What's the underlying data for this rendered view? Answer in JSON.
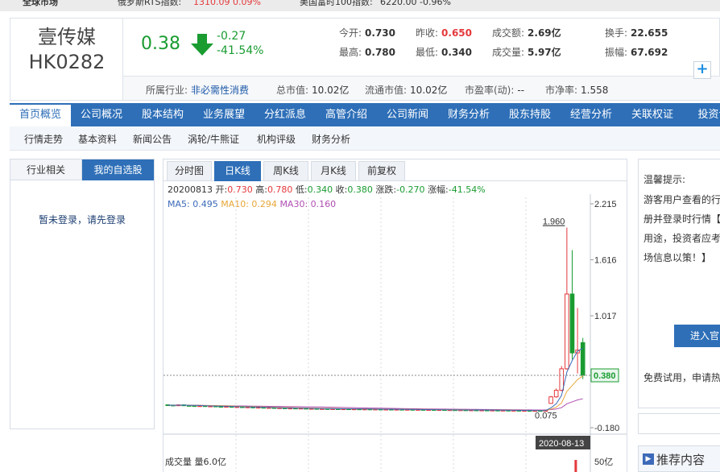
{
  "ticker": {
    "item1_label": "俄罗斯RTS指数:",
    "item1_value": "1310.09 0.09%",
    "item2_label": "美国富时100指数:",
    "item2_value": "6220.00 -0.96%",
    "first_label": "全球市场"
  },
  "stock": {
    "name": "壹传媒",
    "code": "HK0282",
    "price": "0.38",
    "change": "-0.27",
    "change_pct": "-41.54%",
    "open_label": "今开:",
    "open": "0.730",
    "prev_close_label": "昨收:",
    "prev_close": "0.650",
    "turnover_label": "成交额:",
    "turnover": "2.69亿",
    "turnover_rate_label": "换手:",
    "turnover_rate": "22.655",
    "high_label": "最高:",
    "high": "0.780",
    "low_label": "最低:",
    "low": "0.340",
    "volume_label": "成交量:",
    "volume": "5.97亿",
    "amplitude_label": "振幅:",
    "amplitude": "67.692"
  },
  "info": {
    "industry_label": "所属行业:",
    "industry": "非必需性消费",
    "mcap_label": "总市值:",
    "mcap": "10.02亿",
    "float_mcap_label": "流通市值:",
    "float_mcap": "10.02亿",
    "pe_label": "市盈率(动):",
    "pe": "--",
    "pb_label": "市净率:",
    "pb": "1.558",
    "plus_label": "+"
  },
  "main_nav": [
    "首页概览",
    "公司概况",
    "股本结构",
    "业务展望",
    "分红派息",
    "高管介绍",
    "公司新闻",
    "财务分析",
    "股东持股",
    "经营分析",
    "关联权证",
    "投资评"
  ],
  "sub_nav": [
    "行情走势",
    "基本资料",
    "新闻公告",
    "涡轮/牛熊证",
    "机构评级",
    "财务分析"
  ],
  "left_panel": {
    "tab1": "行业相关",
    "tab2": "我的自选股",
    "login_msg": "暂未登录，请先登录"
  },
  "chart_tabs": [
    "分时图",
    "日K线",
    "周K线",
    "月K线",
    "前复权"
  ],
  "ohlc": {
    "date": "20200813",
    "open_label": "开:",
    "open": "0.730",
    "high_label": "高:",
    "high": "0.780",
    "low_label": "低:",
    "low": "0.340",
    "close_label": "收:",
    "close": "0.380",
    "change_label": "涨跌:",
    "change": "-0.270",
    "pct_label": "涨幅:",
    "pct": "-41.54%"
  },
  "ma": {
    "ma5": "MA5: 0.495",
    "ma10": "MA10: 0.294",
    "ma30": "MA30: 0.160"
  },
  "chart_data": {
    "type": "candlestick",
    "y_ticks": [
      "2.215",
      "1.616",
      "1.017",
      "0.380",
      "-0.180"
    ],
    "ylim": [
      -0.18,
      2.215
    ],
    "max_label": "1.960",
    "min_label": "0.075",
    "current_price_label": "0.380",
    "date_label": "2020-08-13",
    "colors": {
      "up": "#e4393c",
      "down": "#1a9c31",
      "ma5": "#3d6ab8",
      "ma10": "#e7a73a",
      "ma30": "#b04fb3"
    },
    "candles": [
      {
        "o": 0.065,
        "h": 0.07,
        "l": 0.058,
        "c": 0.062
      },
      {
        "o": 0.062,
        "h": 0.066,
        "l": 0.056,
        "c": 0.059
      },
      {
        "o": 0.06,
        "h": 0.068,
        "l": 0.055,
        "c": 0.064
      },
      {
        "o": 0.064,
        "h": 0.068,
        "l": 0.058,
        "c": 0.06
      },
      {
        "o": 0.058,
        "h": 0.062,
        "l": 0.052,
        "c": 0.056
      },
      {
        "o": 0.056,
        "h": 0.06,
        "l": 0.05,
        "c": 0.054
      },
      {
        "o": 0.053,
        "h": 0.058,
        "l": 0.048,
        "c": 0.055
      },
      {
        "o": 0.055,
        "h": 0.058,
        "l": 0.049,
        "c": 0.05
      },
      {
        "o": 0.05,
        "h": 0.054,
        "l": 0.046,
        "c": 0.052
      },
      {
        "o": 0.052,
        "h": 0.056,
        "l": 0.047,
        "c": 0.049
      },
      {
        "o": 0.048,
        "h": 0.052,
        "l": 0.044,
        "c": 0.046
      },
      {
        "o": 0.046,
        "h": 0.05,
        "l": 0.042,
        "c": 0.048
      },
      {
        "o": 0.047,
        "h": 0.05,
        "l": 0.041,
        "c": 0.043
      },
      {
        "o": 0.043,
        "h": 0.047,
        "l": 0.039,
        "c": 0.045
      },
      {
        "o": 0.044,
        "h": 0.047,
        "l": 0.038,
        "c": 0.04
      },
      {
        "o": 0.04,
        "h": 0.044,
        "l": 0.036,
        "c": 0.042
      },
      {
        "o": 0.041,
        "h": 0.044,
        "l": 0.035,
        "c": 0.037
      },
      {
        "o": 0.037,
        "h": 0.041,
        "l": 0.033,
        "c": 0.039
      },
      {
        "o": 0.038,
        "h": 0.041,
        "l": 0.032,
        "c": 0.034
      },
      {
        "o": 0.034,
        "h": 0.038,
        "l": 0.03,
        "c": 0.036
      },
      {
        "o": 0.035,
        "h": 0.038,
        "l": 0.029,
        "c": 0.031
      },
      {
        "o": 0.031,
        "h": 0.035,
        "l": 0.027,
        "c": 0.033
      },
      {
        "o": 0.032,
        "h": 0.035,
        "l": 0.026,
        "c": 0.028
      },
      {
        "o": 0.028,
        "h": 0.032,
        "l": 0.024,
        "c": 0.03
      },
      {
        "o": 0.03,
        "h": 0.034,
        "l": 0.025,
        "c": 0.027
      },
      {
        "o": 0.027,
        "h": 0.031,
        "l": 0.023,
        "c": 0.029
      },
      {
        "o": 0.028,
        "h": 0.03,
        "l": 0.022,
        "c": 0.024
      },
      {
        "o": 0.024,
        "h": 0.028,
        "l": 0.02,
        "c": 0.026
      },
      {
        "o": 0.026,
        "h": 0.029,
        "l": 0.02,
        "c": 0.022
      },
      {
        "o": 0.022,
        "h": 0.026,
        "l": 0.018,
        "c": 0.024
      },
      {
        "o": 0.024,
        "h": 0.027,
        "l": 0.019,
        "c": 0.021
      },
      {
        "o": 0.021,
        "h": 0.025,
        "l": 0.017,
        "c": 0.023
      },
      {
        "o": 0.023,
        "h": 0.026,
        "l": 0.018,
        "c": 0.02
      },
      {
        "o": 0.02,
        "h": 0.024,
        "l": 0.016,
        "c": 0.022
      },
      {
        "o": 0.022,
        "h": 0.025,
        "l": 0.017,
        "c": 0.019
      },
      {
        "o": 0.019,
        "h": 0.023,
        "l": 0.015,
        "c": 0.021
      },
      {
        "o": 0.021,
        "h": 0.024,
        "l": 0.016,
        "c": 0.018
      },
      {
        "o": 0.018,
        "h": 0.022,
        "l": 0.014,
        "c": 0.02
      },
      {
        "o": 0.02,
        "h": 0.023,
        "l": 0.015,
        "c": 0.017
      },
      {
        "o": 0.017,
        "h": 0.02,
        "l": 0.013,
        "c": 0.019
      },
      {
        "o": 0.019,
        "h": 0.022,
        "l": 0.014,
        "c": 0.016
      },
      {
        "o": 0.016,
        "h": 0.02,
        "l": 0.012,
        "c": 0.018
      },
      {
        "o": 0.018,
        "h": 0.021,
        "l": 0.013,
        "c": 0.015
      },
      {
        "o": 0.015,
        "h": 0.019,
        "l": 0.012,
        "c": 0.017
      },
      {
        "o": 0.017,
        "h": 0.02,
        "l": 0.012,
        "c": 0.014
      },
      {
        "o": 0.014,
        "h": 0.018,
        "l": 0.011,
        "c": 0.016
      },
      {
        "o": 0.016,
        "h": 0.019,
        "l": 0.011,
        "c": 0.013
      },
      {
        "o": 0.013,
        "h": 0.017,
        "l": 0.01,
        "c": 0.015
      },
      {
        "o": 0.015,
        "h": 0.018,
        "l": 0.01,
        "c": 0.012
      },
      {
        "o": 0.012,
        "h": 0.016,
        "l": 0.009,
        "c": 0.014
      },
      {
        "o": 0.014,
        "h": 0.017,
        "l": 0.009,
        "c": 0.011
      },
      {
        "o": 0.011,
        "h": 0.015,
        "l": 0.008,
        "c": 0.013
      },
      {
        "o": 0.013,
        "h": 0.016,
        "l": 0.008,
        "c": 0.01
      },
      {
        "o": 0.01,
        "h": 0.014,
        "l": 0.007,
        "c": 0.012
      },
      {
        "o": 0.012,
        "h": 0.015,
        "l": 0.007,
        "c": 0.009
      },
      {
        "o": 0.009,
        "h": 0.013,
        "l": 0.006,
        "c": 0.011
      },
      {
        "o": 0.011,
        "h": 0.014,
        "l": 0.006,
        "c": 0.008
      },
      {
        "o": 0.008,
        "h": 0.012,
        "l": 0.005,
        "c": 0.01
      },
      {
        "o": 0.01,
        "h": 0.013,
        "l": 0.005,
        "c": 0.007
      },
      {
        "o": 0.007,
        "h": 0.011,
        "l": 0.004,
        "c": 0.009
      },
      {
        "o": 0.009,
        "h": 0.012,
        "l": 0.004,
        "c": 0.006
      },
      {
        "o": 0.006,
        "h": 0.01,
        "l": 0.003,
        "c": 0.008
      },
      {
        "o": 0.008,
        "h": 0.011,
        "l": 0.003,
        "c": 0.005
      },
      {
        "o": 0.005,
        "h": 0.009,
        "l": 0.002,
        "c": 0.007
      },
      {
        "o": 0.007,
        "h": 0.01,
        "l": 0.002,
        "c": 0.004
      },
      {
        "o": 0.004,
        "h": 0.008,
        "l": 0.001,
        "c": 0.006
      },
      {
        "o": 0.006,
        "h": 0.009,
        "l": 0.001,
        "c": 0.003
      },
      {
        "o": 0.003,
        "h": 0.007,
        "l": 0.0,
        "c": 0.005
      },
      {
        "o": 0.005,
        "h": 0.008,
        "l": 0.0,
        "c": 0.002
      },
      {
        "o": 0.002,
        "h": 0.006,
        "l": 0.0,
        "c": 0.004
      },
      {
        "o": 0.004,
        "h": 0.007,
        "l": 0.0,
        "c": 0.002
      },
      {
        "o": 0.002,
        "h": 0.006,
        "l": 0.0,
        "c": 0.004
      },
      {
        "o": 0.08,
        "h": 0.16,
        "l": 0.075,
        "c": 0.15
      },
      {
        "o": 0.15,
        "h": 0.24,
        "l": 0.14,
        "c": 0.22
      },
      {
        "o": 0.22,
        "h": 0.48,
        "l": 0.21,
        "c": 0.45
      },
      {
        "o": 0.45,
        "h": 1.96,
        "l": 0.44,
        "c": 1.25
      },
      {
        "o": 1.25,
        "h": 1.72,
        "l": 0.55,
        "c": 0.62
      },
      {
        "o": 0.62,
        "h": 1.1,
        "l": 0.4,
        "c": 0.65
      },
      {
        "o": 0.73,
        "h": 0.78,
        "l": 0.34,
        "c": 0.38
      }
    ],
    "volume_label": "成交量 量6.0亿",
    "volume_axis_label": "50亿"
  },
  "right_panel": {
    "tip_title": "温馨提示:",
    "tip_body": "游客用户查看的行钟，请注册并登录时行情【基本市场用途，投资者应考详细的市场信息以策！】",
    "enter_button": "进入官",
    "free_trial": "免费试用，申请热"
  },
  "recommend": {
    "icon": "▶",
    "label": "推荐内容"
  }
}
